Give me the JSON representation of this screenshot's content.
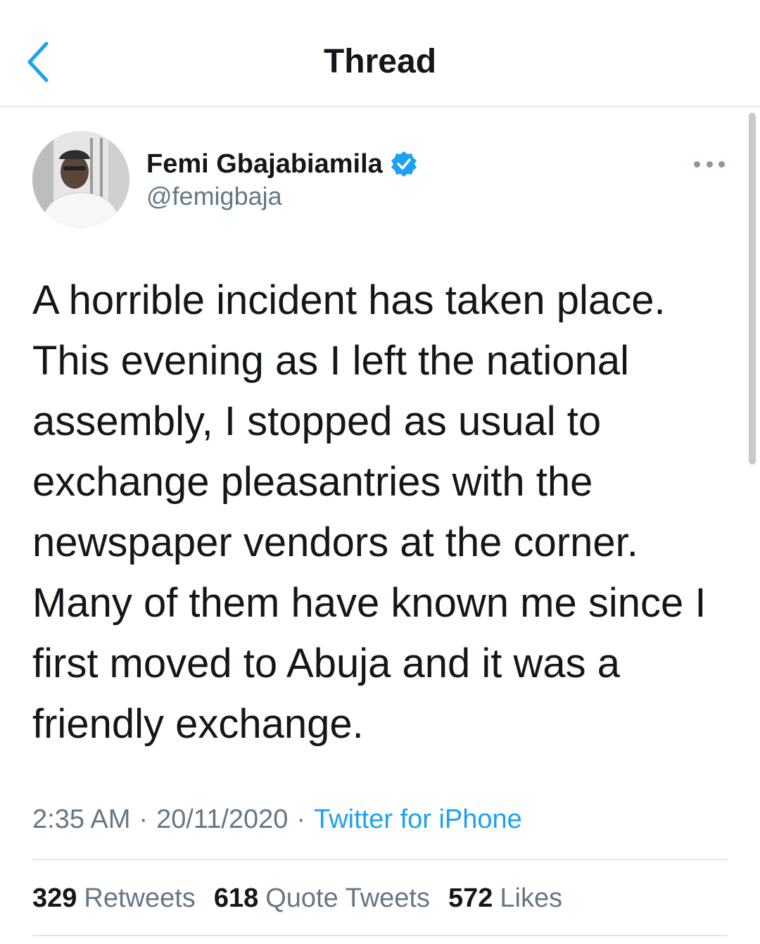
{
  "header": {
    "title": "Thread",
    "back_icon": "chevron-left-icon",
    "accent_color": "#1da1f2"
  },
  "tweet": {
    "author": {
      "display_name": "Femi Gbajabiamila",
      "handle": "@femigbaja",
      "verified": true
    },
    "text_lines": [
      "A horrible incident has taken place.",
      "This evening as I left the national",
      "assembly, I stopped as usual to",
      "exchange pleasantries with the",
      "newspaper vendors at the corner.",
      "Many of them have known me since I",
      "first moved to Abuja and it was a",
      "friendly exchange."
    ],
    "time": "2:35 AM",
    "date": "20/11/2020",
    "separator": "·",
    "source": "Twitter for iPhone",
    "stats": {
      "retweets": {
        "count": "329",
        "label": "Retweets"
      },
      "quote_tweets": {
        "count": "618",
        "label": "Quote Tweets"
      },
      "likes": {
        "count": "572",
        "label": "Likes"
      }
    }
  }
}
